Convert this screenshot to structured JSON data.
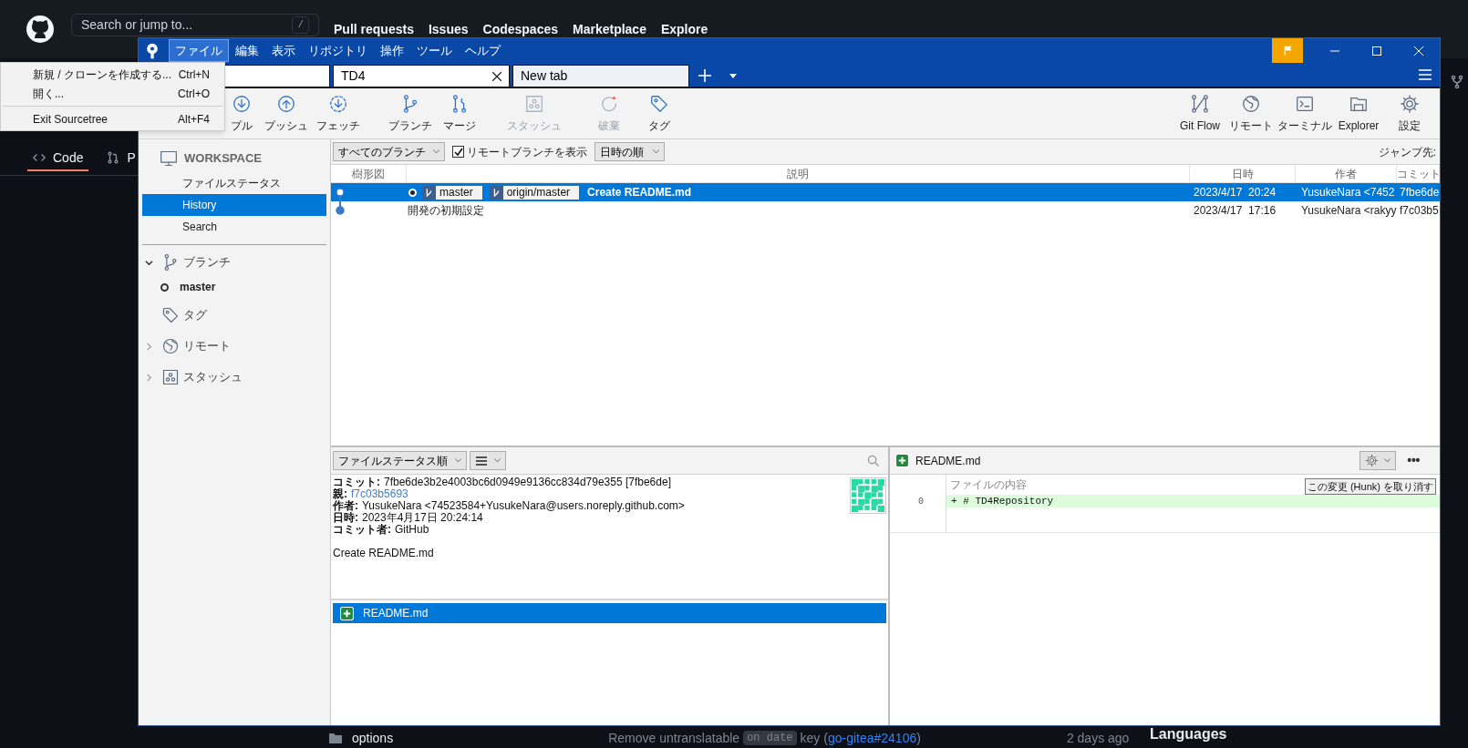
{
  "background": {
    "search": {
      "placeholder": "Search or jump to...",
      "key": "/"
    },
    "nav": [
      "Pull requests",
      "Issues",
      "Codespaces",
      "Marketplace",
      "Explore"
    ],
    "repo_tabs": [
      {
        "label": "Code",
        "selected": true
      },
      {
        "label": "P",
        "selected": false
      }
    ],
    "file_row": {
      "name": "options",
      "message": [
        {
          "kind": "text",
          "text": "Remove untranslatable"
        },
        {
          "kind": "code",
          "text": "on date"
        },
        {
          "kind": "text",
          "text": "key ("
        },
        {
          "kind": "link",
          "text": "go-gitea#24106"
        },
        {
          "kind": "text",
          "text": ")"
        }
      ],
      "age": "2 days ago"
    },
    "aside_heading": "Languages"
  },
  "window": {
    "menu": [
      {
        "label": "ファイル",
        "selected": true
      },
      {
        "label": "編集",
        "selected": false
      },
      {
        "label": "表示",
        "selected": false
      },
      {
        "label": "リポジトリ",
        "selected": false
      },
      {
        "label": "操作",
        "selected": false
      },
      {
        "label": "ツール",
        "selected": false
      },
      {
        "label": "ヘルプ",
        "selected": false
      }
    ],
    "file_menu": [
      {
        "kind": "item",
        "label": "新規 / クローンを作成する...",
        "shortcut": "Ctrl+N"
      },
      {
        "kind": "item",
        "label": "開く...",
        "shortcut": "Ctrl+O"
      },
      {
        "kind": "separator"
      },
      {
        "kind": "item",
        "label": "Exit Sourcetree",
        "shortcut": "Alt+F4"
      }
    ],
    "tabs": [
      {
        "label": "TD4",
        "selected": true
      },
      {
        "label": "New tab",
        "selected": false
      }
    ],
    "toolbar": [
      {
        "kind": "pull",
        "label": "プル",
        "disabled": false
      },
      {
        "kind": "push",
        "label": "プッシュ",
        "disabled": false
      },
      {
        "kind": "fetch",
        "label": "フェッチ",
        "disabled": false
      },
      {
        "kind": "branch",
        "label": "ブランチ",
        "disabled": false
      },
      {
        "kind": "merge",
        "label": "マージ",
        "disabled": false
      },
      {
        "kind": "stash",
        "label": "スタッシュ",
        "disabled": true
      },
      {
        "kind": "discard",
        "label": "破棄",
        "disabled": true
      },
      {
        "kind": "tag",
        "label": "タグ",
        "disabled": false
      }
    ],
    "toolbar_right": [
      {
        "kind": "gitflow",
        "label": "Git Flow"
      },
      {
        "kind": "remote",
        "label": "リモート"
      },
      {
        "kind": "terminal",
        "label": "ターミナル"
      },
      {
        "kind": "explorer",
        "label": "Explorer"
      },
      {
        "kind": "settings",
        "label": "設定"
      }
    ],
    "sidebar": {
      "heading": "WORKSPACE",
      "items": [
        {
          "label": "ファイルステータス",
          "selected": false
        },
        {
          "label": "History",
          "selected": true
        },
        {
          "label": "Search",
          "selected": false
        }
      ],
      "groups": [
        {
          "kind": "branch",
          "label": "ブランチ",
          "expanded": true,
          "children": [
            {
              "label": "master",
              "current": true
            }
          ]
        },
        {
          "kind": "tag",
          "label": "タグ"
        },
        {
          "kind": "remote",
          "label": "リモート",
          "expanded": false
        },
        {
          "kind": "stash",
          "label": "スタッシュ",
          "expanded": false
        }
      ]
    },
    "filter": {
      "branches": "すべてのブランチ",
      "show_remote": {
        "label": "リモートブランチを表示",
        "checked": true
      },
      "order": "日時の順",
      "jump": "ジャンプ先:"
    },
    "history": {
      "columns": [
        "樹形図",
        "説明",
        "日時",
        "作者",
        "コミット"
      ],
      "commits": [
        {
          "selected": true,
          "head": true,
          "refs": [
            "master",
            "origin/master"
          ],
          "description": "Create README.md",
          "date": "2023/4/17  20:24",
          "author": "YusukeNara <7452",
          "commit": "7fbe6de"
        },
        {
          "selected": false,
          "head": false,
          "description": "開発の初期設定",
          "date": "2023/4/17  17:16",
          "author": "YusukeNara <rakyy",
          "commit": "f7c03b5"
        }
      ]
    },
    "details": {
      "sort": "ファイルステータス順",
      "lines": [
        {
          "label": "コミット:",
          "value": "7fbe6de3b2e4003bc6d0949e9136cc834d79e355 [7fbe6de]"
        },
        {
          "label": "親:",
          "value": "f7c03b5693",
          "kind": "link"
        },
        {
          "label": "作者:",
          "value": "YusukeNara <74523584+YusukeNara@users.noreply.github.com>"
        },
        {
          "label": "日時:",
          "value": "2023年4月17日 20:24:14"
        },
        {
          "label": "コミット者:",
          "value": "GitHub"
        }
      ],
      "message": "Create README.md",
      "files": [
        {
          "name": "README.md",
          "kind": "added",
          "selected": true
        }
      ]
    },
    "diff": {
      "file": "README.md",
      "kind": "added",
      "header": "ファイルの内容",
      "hunk_button": "この変更 (Hunk) を取り消す",
      "more": "•••",
      "lines": [
        {
          "number": "0",
          "text": "+ # TD4Repository",
          "kind": "added"
        }
      ]
    }
  }
}
